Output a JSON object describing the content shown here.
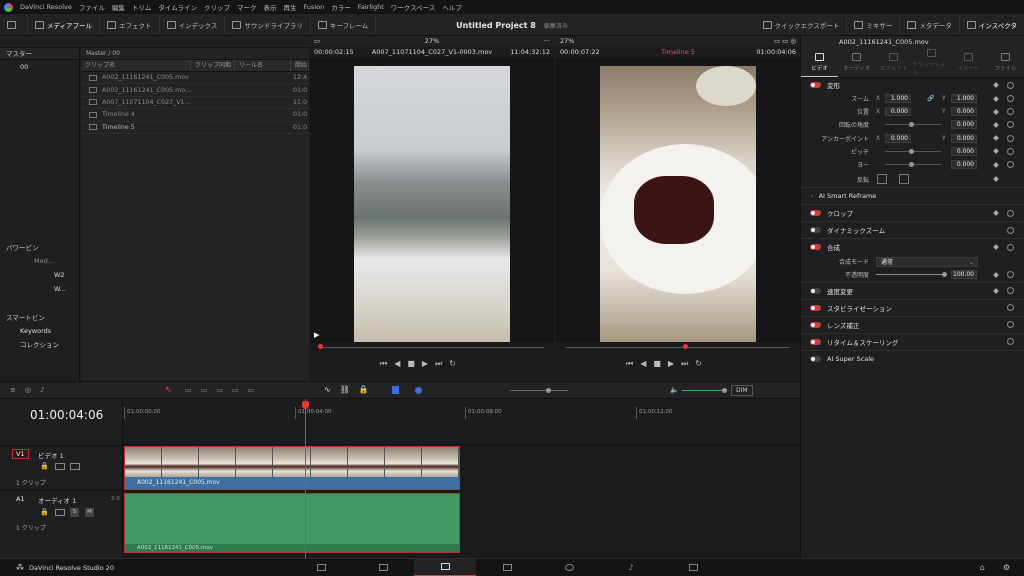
{
  "menubar": {
    "app_name": "DaVinci Resolve",
    "items": [
      "ファイル",
      "編集",
      "トリム",
      "タイムライン",
      "クリップ",
      "マーク",
      "表示",
      "再生",
      "Fusion",
      "カラー",
      "Fairlight",
      "ワークスペース",
      "ヘルプ"
    ]
  },
  "toolbar": {
    "left": [
      "メディアプール",
      "エフェクト",
      "インデックス",
      "サウンドライブラリ",
      "キーフレーム"
    ],
    "right": [
      "クイックエクスポート",
      "ミキサー",
      "メタデータ",
      "インスペクタ"
    ],
    "project_title": "Untitled Project 8",
    "project_status": "編集済み"
  },
  "left_panel": {
    "master_header": "マスター",
    "master_item": "00",
    "power_bins_header": "パワービン",
    "power_bin_items": [
      "Med...",
      "W2",
      "W..."
    ],
    "smart_bins_header": "スマートビン",
    "smart_bin_items": [
      "Keywords",
      "コレクション"
    ]
  },
  "media_pool": {
    "path": "Master / 00",
    "columns": [
      "クリップ名",
      "クリップ同期",
      "リール名",
      "開始"
    ],
    "clips": [
      {
        "name": "A002_11161241_C005.mov",
        "tc": "12:4"
      },
      {
        "name": "A002_11161241_C005.mo...",
        "tc": "01:0"
      },
      {
        "name": "A007_11071104_C027_V1...",
        "tc": "11:0"
      },
      {
        "name": "Timeline 4",
        "tc": "01:0"
      },
      {
        "name": "Timeline 5",
        "tc": "01:0"
      }
    ]
  },
  "source_viewer": {
    "zoom": "27%",
    "timecode_left": "00:00:02:15",
    "clip_name": "A007_11071104_C027_V1-0003.mov",
    "timecode_right": "11:04:32:12"
  },
  "timeline_viewer": {
    "zoom": "27%",
    "timecode_left": "00:00:07:22",
    "timeline_name": "Timeline 5",
    "timecode_right": "01:00:04:06"
  },
  "inspector": {
    "clip_title": "A002_11161241_C005.mov",
    "tabs": [
      "ビデオ",
      "オーディオ",
      "エフェクト",
      "トランジション",
      "イメージ",
      "ファイル"
    ],
    "transform": {
      "header": "変形",
      "zoom_label": "ズーム",
      "zoom_x": "1.000",
      "zoom_y": "1.000",
      "position_label": "位置",
      "position_x": "0.000",
      "position_y": "0.000",
      "rotation_label": "回転の角度",
      "rotation": "0.000",
      "anchor_label": "アンカーポイント",
      "anchor_x": "0.000",
      "anchor_y": "0.000",
      "pitch_label": "ピッチ",
      "pitch": "0.000",
      "yaw_label": "ヨー",
      "yaw": "0.000",
      "flip_label": "反転"
    },
    "ai_smart_reframe": "AI Smart Reframe",
    "crop": "クロップ",
    "dynamic_zoom": "ダイナミックズーム",
    "composite": {
      "header": "合成",
      "mode_label": "合成モード",
      "mode_value": "通常",
      "opacity_label": "不透明度",
      "opacity_value": "100.00"
    },
    "speed_change": "速度変更",
    "stabilization": "スタビライゼーション",
    "lens_correction": "レンズ補正",
    "retime_scaling": "リタイム＆スケーリング",
    "ai_super_scale": "AI Super Scale"
  },
  "timeline": {
    "current_timecode": "01:00:04:06",
    "ruler": [
      "01:00:00:00",
      "01:00:04:00",
      "01:00:08:00",
      "01:00:12:00"
    ],
    "video_track": {
      "id": "V1",
      "name": "ビデオ 1",
      "clip_count": "1 クリップ",
      "clip_name": "A002_11161241_C005.mov"
    },
    "audio_track": {
      "id": "A1",
      "name": "オーディオ 1",
      "channels": "2.0",
      "clip_count": "1 クリップ",
      "clip_name": "A002_11161241_C005.mov"
    },
    "dim_label": "DIM"
  },
  "bottombar": {
    "product": "DaVinci Resolve Studio 20"
  }
}
